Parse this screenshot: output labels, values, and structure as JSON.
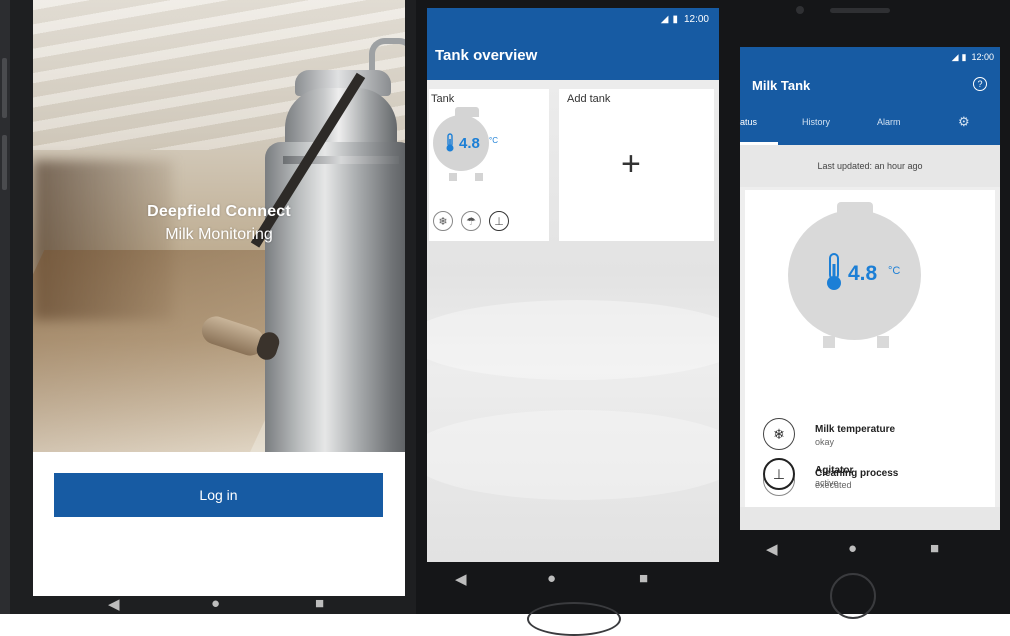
{
  "login_screen": {
    "app_name": "Deepfield Connect",
    "app_subtitle": "Milk Monitoring",
    "login_button": "Log in"
  },
  "overview_screen": {
    "status_time": "12:00",
    "title": "Tank overview",
    "tank_card": {
      "label": "Tank",
      "temperature": "4.8",
      "unit": "°C",
      "icons": [
        "snowflake-icon",
        "cleaning-spray-icon",
        "agitator-icon"
      ]
    },
    "add_card": {
      "label": "Add tank",
      "plus_glyph": "+"
    }
  },
  "detail_screen": {
    "status_time": "12:00",
    "title": "Milk Tank",
    "tabs": [
      "atus",
      "History",
      "Alarm"
    ],
    "last_updated": "Last updated: an hour ago",
    "temperature": "4.8",
    "unit": "°C",
    "statuses": [
      {
        "icon": "snowflake-icon",
        "title": "Milk temperature",
        "value": "okay"
      },
      {
        "icon": "cleaning-spray-icon",
        "title": "Cleaning process",
        "value": "executed"
      },
      {
        "icon": "agitator-icon",
        "title": "Agitator",
        "value": "active"
      }
    ]
  },
  "colors": {
    "brand_blue": "#175ba3",
    "temperature_blue": "#1c7fd6"
  }
}
